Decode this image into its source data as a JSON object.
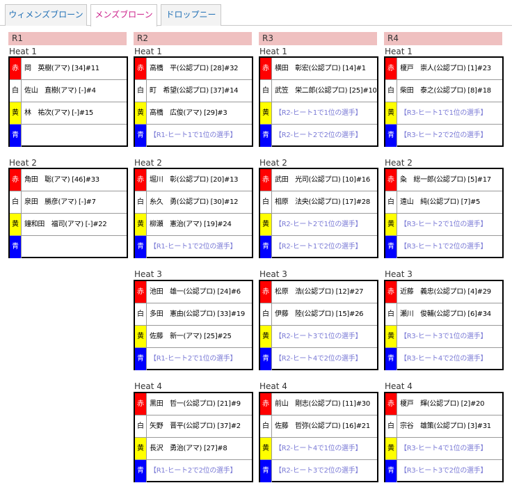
{
  "colors": {
    "red": "#ff0000",
    "white": "#ffffff",
    "yellow": "#ffff00",
    "blue": "#0000ff",
    "round_header_bg": "#efc0c0",
    "tab_women_text": "#1f6fb5",
    "tab_men_text": "#cc1f8a",
    "tab_draft_text": "#1f6fb5",
    "placeholder_text": "#7b7bd6"
  },
  "tabs": [
    {
      "label": "ウィメンズブローン",
      "active": false
    },
    {
      "label": "メンズブローン",
      "active": true
    },
    {
      "label": "ドロップニー",
      "active": false
    }
  ],
  "lane_labels": {
    "red": "赤",
    "white": "白",
    "yellow": "黄",
    "blue": "青"
  },
  "rounds": [
    {
      "label": "R1",
      "heats": [
        {
          "title": "Heat 1",
          "lanes": [
            "岡　英樹(アマ) [34]#11",
            "佐山　直樹(アマ) [-]#4",
            "林　祐次(アマ) [-]#15",
            ""
          ]
        },
        {
          "title": "Heat 2",
          "lanes": [
            "角田　聡(アマ) [46]#33",
            "泉田　勝彦(アマ) [-]#7",
            "鐘和田　福司(アマ) [-]#22",
            ""
          ]
        }
      ]
    },
    {
      "label": "R2",
      "heats": [
        {
          "title": "Heat 1",
          "lanes": [
            "高橋　平(公認プロ) [28]#32",
            "町　希望(公認プロ) [37]#14",
            "高橋　広俊(アマ) [29]#3",
            "【R1-ヒート1で1位の選手】"
          ]
        },
        {
          "title": "Heat 2",
          "lanes": [
            "堀川　彰(公認プロ) [20]#13",
            "糸久　勇(公認プロ) [30]#12",
            "柳瀬　憲治(アマ) [19]#24",
            "【R1-ヒート1で2位の選手】"
          ]
        },
        {
          "title": "Heat 3",
          "lanes": [
            "池田　雄一(公認プロ) [24]#6",
            "多田　憲由(公認プロ) [33]#19",
            "佐藤　新一(アマ) [25]#25",
            "【R1-ヒート2で1位の選手】"
          ]
        },
        {
          "title": "Heat 4",
          "lanes": [
            "黒田　哲一(公認プロ) [21]#9",
            "矢野　晋平(公認プロ) [37]#2",
            "長沢　勇治(アマ) [27]#8",
            "【R1-ヒート2で2位の選手】"
          ]
        }
      ]
    },
    {
      "label": "R3",
      "heats": [
        {
          "title": "Heat 1",
          "lanes": [
            "横田　彰宏(公認プロ) [14]#1",
            "武笠　栄二郎(公認プロ) [25]#10",
            "【R2-ヒート1で1位の選手】",
            "【R2-ヒート2で2位の選手】"
          ]
        },
        {
          "title": "Heat 2",
          "lanes": [
            "武田　光司(公認プロ) [10]#16",
            "相原　法央(公認プロ) [17]#28",
            "【R2-ヒート2で1位の選手】",
            "【R2-ヒート1で2位の選手】"
          ]
        },
        {
          "title": "Heat 3",
          "lanes": [
            "松原　浩(公認プロ) [12]#27",
            "伊藤　陸(公認プロ) [15]#26",
            "【R2-ヒート3で1位の選手】",
            "【R2-ヒート4で2位の選手】"
          ]
        },
        {
          "title": "Heat 4",
          "lanes": [
            "前山　剛志(公認プロ) [11]#30",
            "佐藤　哲弥(公認プロ) [16]#21",
            "【R2-ヒート4で1位の選手】",
            "【R2-ヒート3で2位の選手】"
          ]
        }
      ]
    },
    {
      "label": "R4",
      "heats": [
        {
          "title": "Heat 1",
          "lanes": [
            "榎戸　崇人(公認プロ) [1]#23",
            "柴田　泰之(公認プロ) [8]#18",
            "【R3-ヒート1で1位の選手】",
            "【R3-ヒート2で2位の選手】"
          ]
        },
        {
          "title": "Heat 2",
          "lanes": [
            "粂　総一郎(公認プロ) [5]#17",
            "遠山　純(公認プロ) [7]#5",
            "【R3-ヒート2で1位の選手】",
            "【R3-ヒート1で2位の選手】"
          ]
        },
        {
          "title": "Heat 3",
          "lanes": [
            "近藤　義忠(公認プロ) [4]#29",
            "瀬川　俊輔(公認プロ) [6]#34",
            "【R3-ヒート3で1位の選手】",
            "【R3-ヒート4で2位の選手】"
          ]
        },
        {
          "title": "Heat 4",
          "lanes": [
            "榎戸　輝(公認プロ) [2]#20",
            "宗谷　雄策(公認プロ) [3]#31",
            "【R3-ヒート4で1位の選手】",
            "【R3-ヒート3で2位の選手】"
          ]
        }
      ]
    }
  ]
}
